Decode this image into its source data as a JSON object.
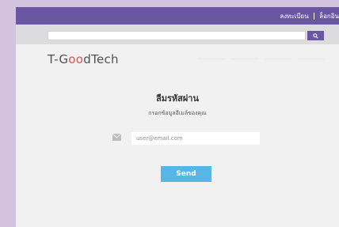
{
  "topbar": {
    "register_label": "ลงทะเบียน",
    "login_label": "ล็อกอิน"
  },
  "search": {
    "placeholder": "",
    "button_icon": "search-icon"
  },
  "logo": {
    "prefix": "T-G",
    "highlight": "oo",
    "suffix": "dTech",
    "highlight_color": "#d9534f"
  },
  "form": {
    "title": "ลืมรหัสผ่าน",
    "subtitle": "กรอกข้อมูลอีเมล์ของคุณ",
    "email_placeholder": "user@email.com",
    "email_value": "",
    "email_icon": "envelope-icon",
    "submit_label": "Send"
  },
  "colors": {
    "brand_purple": "#6b56a3",
    "button_blue": "#57b6e5",
    "background": "#d4c3e0"
  }
}
